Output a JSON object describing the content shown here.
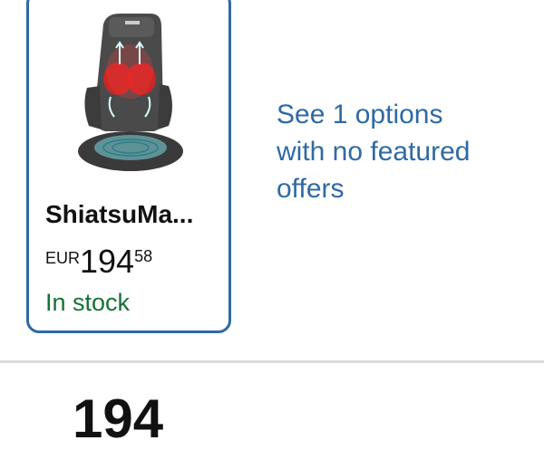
{
  "product_card": {
    "image_icon": "massage-seat-cushion-image",
    "title": "ShiatsuMa...",
    "price": {
      "currency": "EUR",
      "whole": "194",
      "fraction": "58"
    },
    "stock_status": "In stock",
    "stock_color": "#137333",
    "border_color": "#2f6aa3"
  },
  "options_link": {
    "text": "See 1 options with no featured offers",
    "color": "#2f6aa3"
  },
  "next_section": {
    "partial_text": "194"
  }
}
